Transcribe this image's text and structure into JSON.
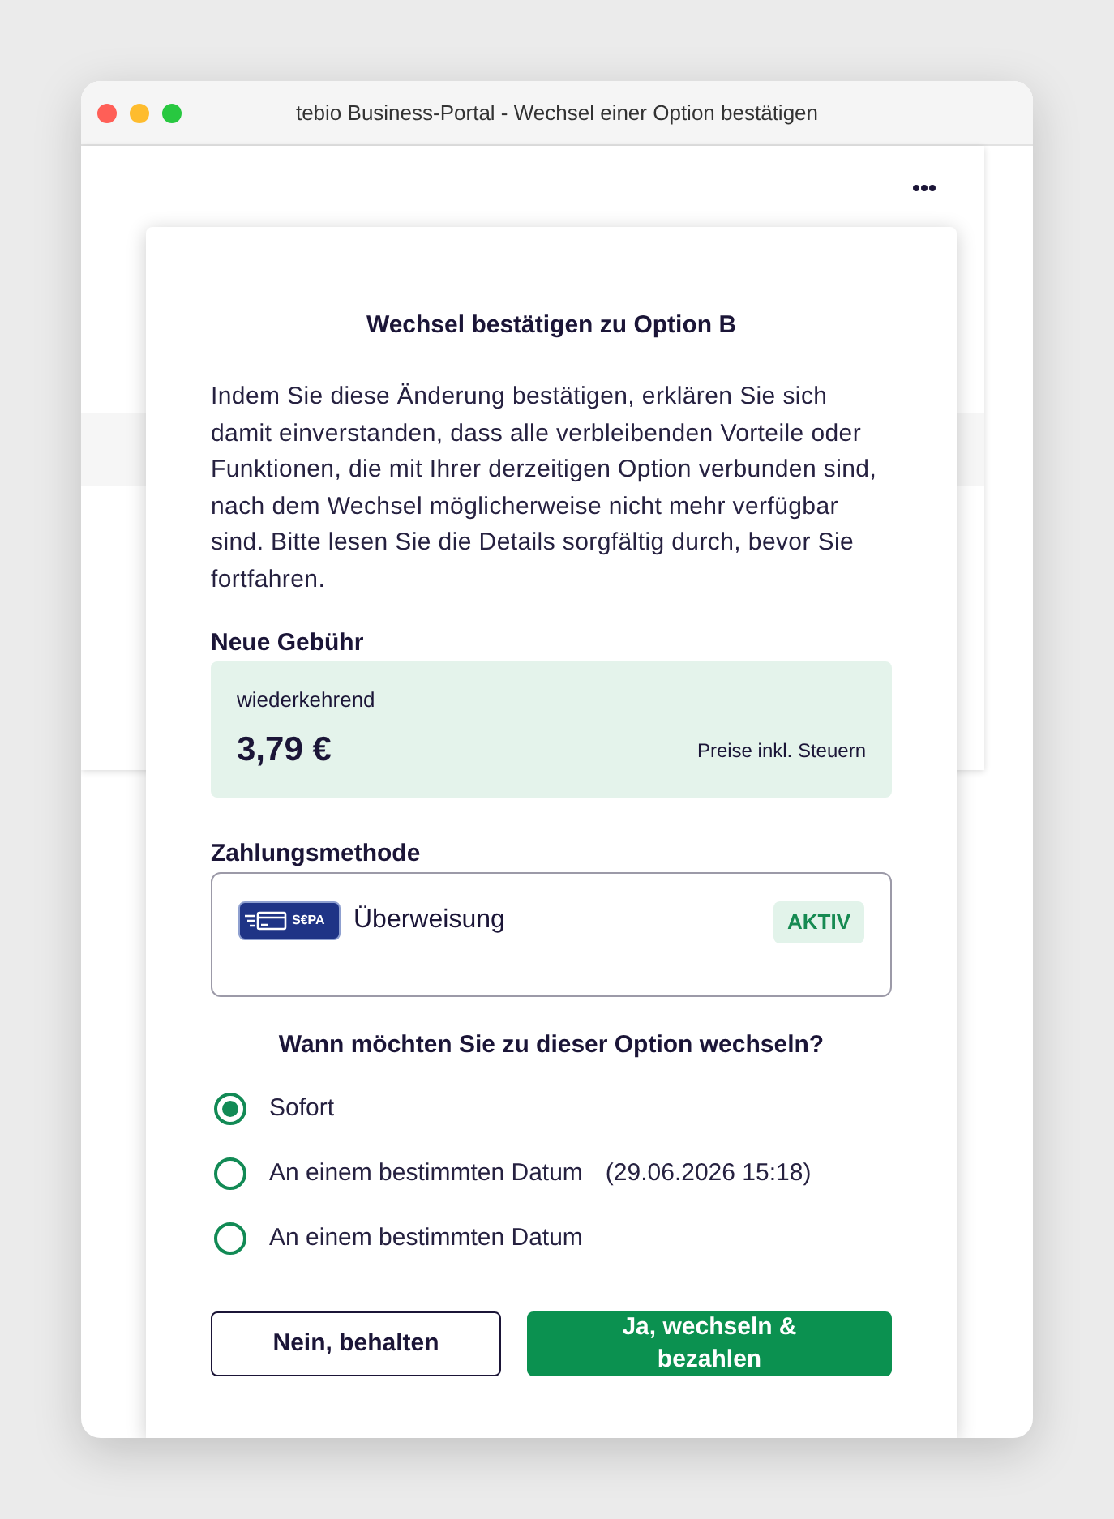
{
  "window": {
    "title": "tebio Business-Portal - Wechsel einer Option bestätigen"
  },
  "dialog": {
    "title": "Wechsel bestätigen zu Option B",
    "description": "Indem Sie diese Änderung bestätigen, erklären Sie sich damit einverstanden, dass alle verbleibenden Vorteile oder Funktionen, die mit Ihrer derzeitigen Option verbunden sind, nach dem Wechsel möglicherweise nicht mehr verfügbar sind. Bitte lesen Sie die Details sorgfältig durch, bevor Sie fortfahren.",
    "fee": {
      "heading": "Neue Gebühr",
      "frequency": "wiederkehrend",
      "amount": "3,79 €",
      "tax_note": "Preise inkl. Steuern"
    },
    "payment": {
      "heading": "Zahlungsmethode",
      "logo_text": "S€PA",
      "method": "Überweisung",
      "status": "AKTIV"
    },
    "schedule": {
      "question": "Wann möchten Sie zu dieser Option wechseln?",
      "options": [
        {
          "label": "Sofort",
          "selected": true
        },
        {
          "label": "An einem bestimmten Datum",
          "date": "(29.06.2026 15:18)",
          "selected": false
        },
        {
          "label": "An einem bestimmten Datum",
          "selected": false
        }
      ]
    },
    "buttons": [
      {
        "label": "Nein, behalten",
        "kind": "secondary"
      },
      {
        "label": "Ja, wechseln & bezahlen",
        "kind": "primary"
      }
    ]
  }
}
